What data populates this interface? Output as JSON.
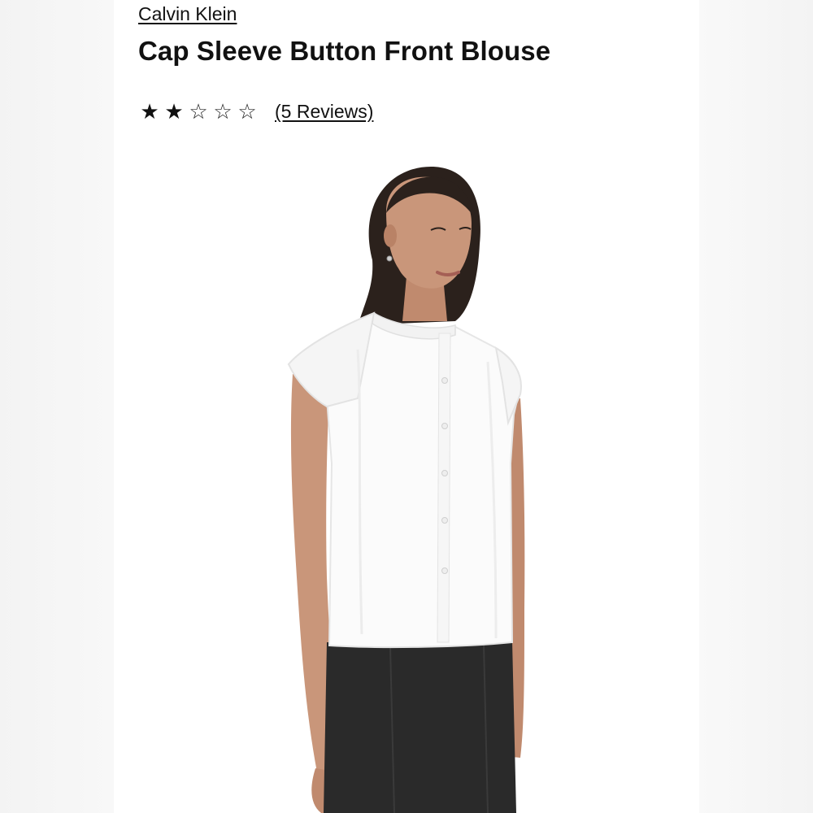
{
  "product": {
    "brand": "Calvin Klein",
    "title": "Cap Sleeve Button Front Blouse",
    "rating": 2,
    "rating_max": 5,
    "reviews_label": "(5 Reviews)"
  },
  "icons": {
    "star_filled": "★",
    "star_empty": "☆"
  },
  "image": {
    "subject": "model-wearing-white-cap-sleeve-blouse",
    "colors": {
      "blouse": "#fbfbfb",
      "pants": "#2a2a2a",
      "hair": "#2b211c",
      "skin": "#c9967a"
    }
  }
}
